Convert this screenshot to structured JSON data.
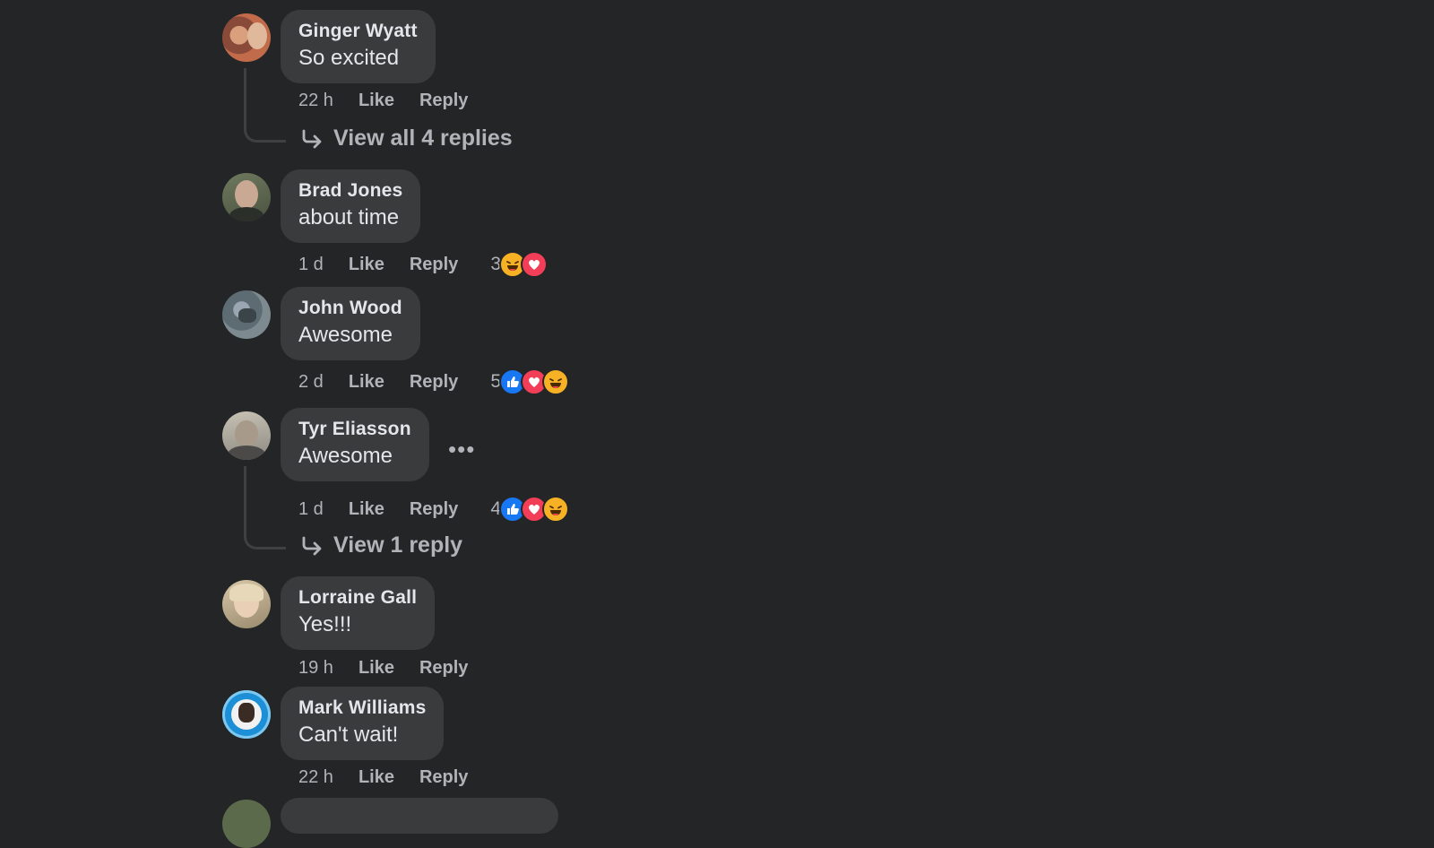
{
  "comments": [
    {
      "author": "Ginger Wyatt",
      "text": "So excited",
      "time": "22 h",
      "like": "Like",
      "reply": "Reply",
      "replies_link": "View all 4 replies"
    },
    {
      "author": "Brad Jones",
      "text": "about time",
      "time": "1 d",
      "like": "Like",
      "reply": "Reply",
      "reaction_count": "3",
      "reactions": [
        "haha",
        "love"
      ]
    },
    {
      "author": "John Wood",
      "text": "Awesome",
      "time": "2 d",
      "like": "Like",
      "reply": "Reply",
      "reaction_count": "5",
      "reactions": [
        "like",
        "love",
        "haha"
      ]
    },
    {
      "author": "Tyr Eliasson",
      "text": "Awesome",
      "time": "1 d",
      "like": "Like",
      "reply": "Reply",
      "reaction_count": "4",
      "reactions": [
        "like",
        "love",
        "haha"
      ],
      "replies_link": "View 1 reply",
      "more": "•••"
    },
    {
      "author": "Lorraine Gall",
      "text": "Yes!!!",
      "time": "19 h",
      "like": "Like",
      "reply": "Reply"
    },
    {
      "author": "Mark Williams",
      "text": "Can't wait!",
      "time": "22 h",
      "like": "Like",
      "reply": "Reply"
    }
  ],
  "colors": {
    "background": "#242526",
    "bubble": "#3a3b3c",
    "text": "#e4e6eb",
    "muted": "#b0b3b8",
    "like": "#1877f2",
    "love": "#f33e58",
    "haha": "#f7b125"
  }
}
